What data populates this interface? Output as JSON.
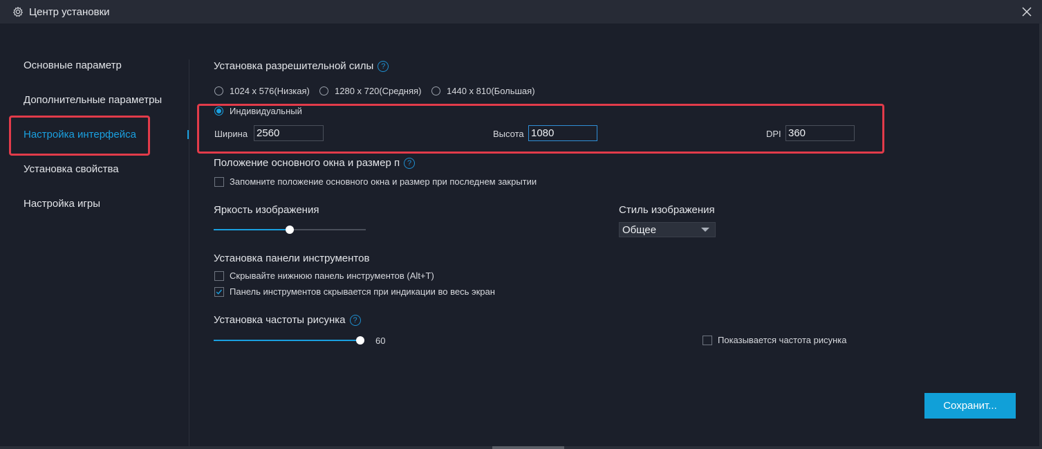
{
  "window": {
    "title": "Центр установки",
    "icons": {
      "title": "gear-icon",
      "close": "close-icon"
    }
  },
  "sidebar": {
    "items": [
      {
        "label": "Основные параметр"
      },
      {
        "label": "Дополнительные параметры"
      },
      {
        "label": "Настройка интерфейса",
        "active": true
      },
      {
        "label": "Установка свойства"
      },
      {
        "label": "Настройка игры"
      }
    ]
  },
  "resolution": {
    "title": "Установка разрешительной силы",
    "help": "?",
    "options": [
      {
        "label": "1024 x 576(Низкая)",
        "selected": false
      },
      {
        "label": "1280 x 720(Средняя)",
        "selected": false
      },
      {
        "label": "1440 x 810(Большая)",
        "selected": false
      },
      {
        "label": "Индивидуальный",
        "selected": true
      }
    ],
    "width_label": "Ширина",
    "width_value": "2560",
    "height_label": "Высота",
    "height_value": "1080",
    "dpi_label": "DPI",
    "dpi_value": "360"
  },
  "window_position": {
    "title": "Положение основного окна и размер п",
    "help": "?",
    "remember_label": "Запомните положение основного окна и размер при последнем закрытии",
    "remember_checked": false
  },
  "brightness": {
    "title": "Яркость изображения",
    "level": 0.5
  },
  "image_style": {
    "title": "Стиль изображения",
    "value": "Общее"
  },
  "toolbar": {
    "title": "Установка панели инструментов",
    "hide_bottom_label": "Скрывайте нижнюю панель инструментов (Alt+T)",
    "hide_bottom_checked": false,
    "hide_fullscreen_label": "Панель инструментов скрывается при индикации во весь экран",
    "hide_fullscreen_checked": true
  },
  "frame_rate": {
    "title": "Установка частоты рисунка",
    "help": "?",
    "value": "60",
    "level": 1.0,
    "show_label": "Показывается частота рисунка",
    "show_checked": false
  },
  "actions": {
    "save_label": "Сохранит..."
  },
  "colors": {
    "accent": "#1aa0e0",
    "highlight_box": "#e23b4a",
    "background": "#1b1f2a",
    "titlebar": "#272b36",
    "button": "#11a0d8"
  }
}
